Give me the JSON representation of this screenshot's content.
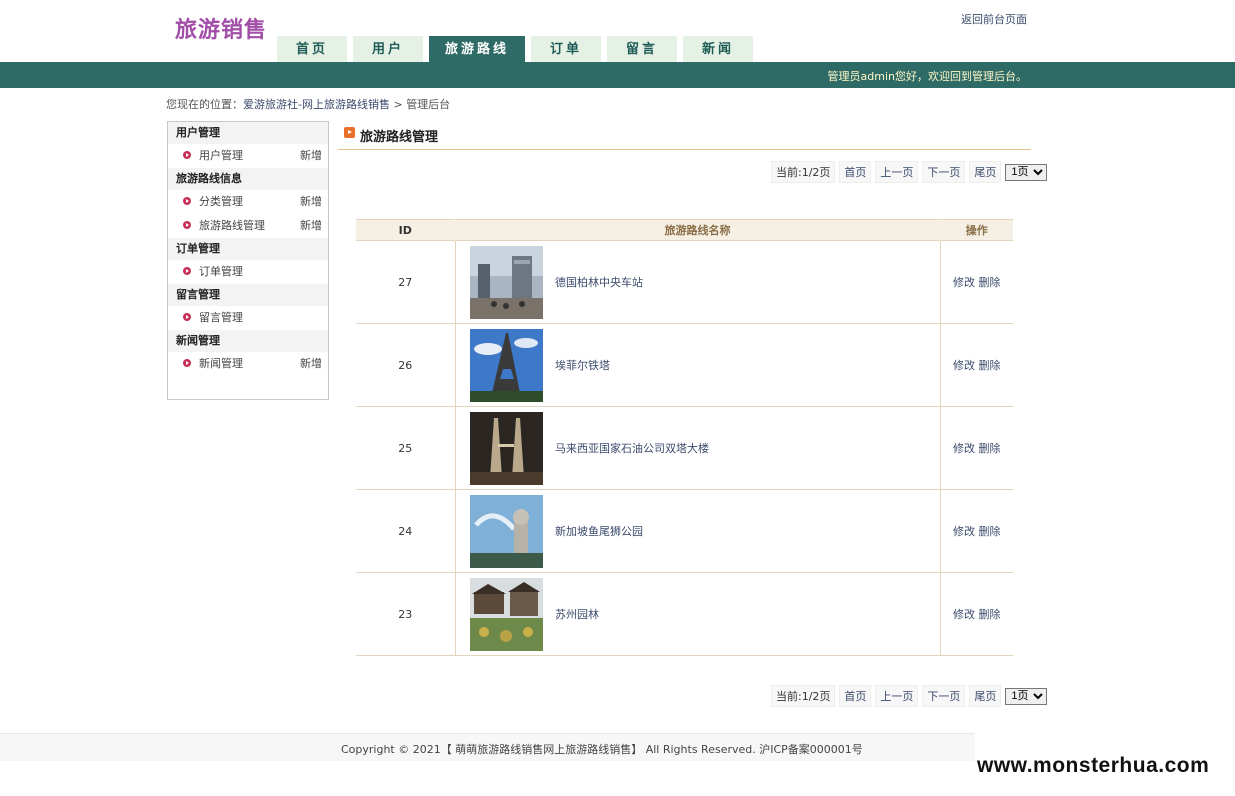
{
  "header": {
    "logo": "旅游销售",
    "back_link": "返回前台页面",
    "nav": [
      {
        "label": "首页"
      },
      {
        "label": "用户"
      },
      {
        "label": "旅游路线"
      },
      {
        "label": "订单"
      },
      {
        "label": "留言"
      },
      {
        "label": "新闻"
      }
    ],
    "active_tab": "旅游路线",
    "welcome": "管理员admin您好，欢迎回到管理后台。"
  },
  "breadcrumb": {
    "prefix": "您现在的位置：",
    "link": "爱游旅游社-网上旅游路线销售",
    "sep": ">",
    "current": "管理后台"
  },
  "sidebar": {
    "groups": [
      {
        "title": "用户管理",
        "items": [
          {
            "label": "用户管理",
            "add": "新增"
          }
        ]
      },
      {
        "title": "旅游路线信息",
        "items": [
          {
            "label": "分类管理",
            "add": "新增"
          },
          {
            "label": "旅游路线管理",
            "add": "新增"
          }
        ]
      },
      {
        "title": "订单管理",
        "items": [
          {
            "label": "订单管理",
            "add": ""
          }
        ]
      },
      {
        "title": "留言管理",
        "items": [
          {
            "label": "留言管理",
            "add": ""
          }
        ]
      },
      {
        "title": "新闻管理",
        "items": [
          {
            "label": "新闻管理",
            "add": "新增"
          }
        ]
      }
    ]
  },
  "main": {
    "title": "旅游路线管理",
    "pager": {
      "current": "当前:1/2页",
      "first": "首页",
      "prev": "上一页",
      "next": "下一页",
      "last": "尾页",
      "select": "1页"
    },
    "table": {
      "headers": [
        "ID",
        "旅游路线名称",
        "操作"
      ],
      "rows": [
        {
          "id": "27",
          "name": "德国柏林中央车站",
          "edit": "修改",
          "delete": "删除"
        },
        {
          "id": "26",
          "name": "埃菲尔铁塔",
          "edit": "修改",
          "delete": "删除"
        },
        {
          "id": "25",
          "name": "马来西亚国家石油公司双塔大楼",
          "edit": "修改",
          "delete": "删除"
        },
        {
          "id": "24",
          "name": "新加坡鱼尾狮公园",
          "edit": "修改",
          "delete": "删除"
        },
        {
          "id": "23",
          "name": "苏州园林",
          "edit": "修改",
          "delete": "删除"
        }
      ]
    }
  },
  "footer": {
    "copyright": "Copyright © 2021【 萌萌旅游路线销售网上旅游路线销售】 All Rights Reserved. 沪ICP备案000001号"
  },
  "watermark": "www.monsterhua.com",
  "colors": {
    "brand": "#2e6b66",
    "logo": "#a24ea8",
    "accent_line": "#e3c58c",
    "table_header": "#f5efe4"
  }
}
